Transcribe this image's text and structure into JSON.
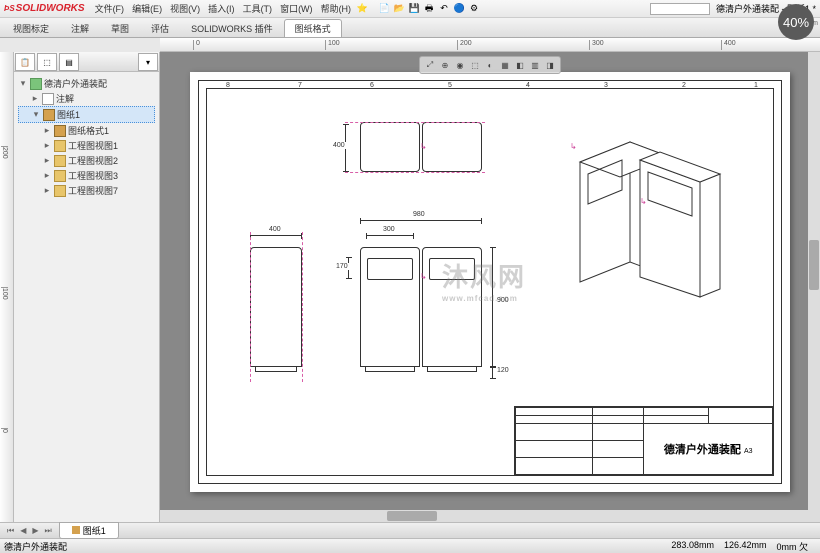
{
  "app": {
    "logo": "SOLIDWORKS",
    "doc_title": "德清户外通装配 - 图纸1 *",
    "clock_badge": "40%",
    "measure": "0.1mm"
  },
  "menus": [
    "文件(F)",
    "编辑(E)",
    "视图(V)",
    "插入(I)",
    "工具(T)",
    "窗口(W)",
    "帮助(H)"
  ],
  "ribbon_tabs": [
    "视图标定",
    "注解",
    "草图",
    "评估",
    "SOLIDWORKS 插件",
    "图纸格式"
  ],
  "hruler": [
    "0",
    "100",
    "200",
    "300",
    "400"
  ],
  "vruler": [
    "0",
    "100",
    "200"
  ],
  "tree": {
    "root": "德清户外通装配",
    "annotation": "注解",
    "sheet": "图纸1",
    "format": "图纸格式1",
    "views": [
      "工程图视图1",
      "工程图视图2",
      "工程图视图3",
      "工程图视图7"
    ]
  },
  "view_toolbar": [
    "⤢",
    "⊕",
    "◉",
    "⬚",
    "◐",
    "▦",
    "◧",
    "▥",
    "◨"
  ],
  "dimensions": {
    "d400_top": "400",
    "d980": "980",
    "d400_side": "400",
    "d300": "300",
    "d170": "170",
    "d900": "900",
    "d120": "120"
  },
  "origin": "↳",
  "watermark": {
    "main": "沐风网",
    "sub": "www.mfcad.com"
  },
  "title_block": {
    "title": "德清户外通装配",
    "size": "A3"
  },
  "sheet_tab": "图纸1",
  "status": {
    "left": "德清户外通装配",
    "coord1": "283.08mm",
    "coord2": "126.42mm",
    "coord3": "0mm 欠"
  },
  "zones_h": [
    "8",
    "7",
    "6",
    "5",
    "4",
    "3",
    "2",
    "1"
  ]
}
